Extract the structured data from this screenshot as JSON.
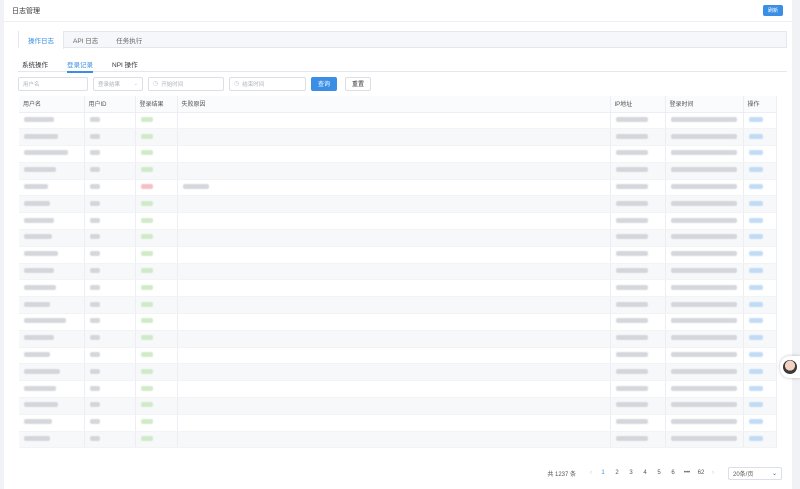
{
  "header": {
    "title": "日志管理",
    "refresh_label": "刷新"
  },
  "top_tabs": [
    {
      "label": "操作日志",
      "active": true
    },
    {
      "label": "API 日志",
      "active": false
    },
    {
      "label": "任务执行",
      "active": false
    }
  ],
  "sub_tabs": [
    {
      "label": "系统操作",
      "active": false
    },
    {
      "label": "登录记录",
      "active": true
    },
    {
      "label": "NPI 操作",
      "active": false
    }
  ],
  "filters": {
    "username_placeholder": "用户名",
    "result_placeholder": "登录结果",
    "start_placeholder": "开始时间",
    "end_placeholder": "结束时间",
    "query_label": "查询",
    "reset_label": "重置"
  },
  "table": {
    "columns": [
      "用户名",
      "用户ID",
      "登录结果",
      "失败原因",
      "IP地址",
      "登录时间",
      "操作"
    ]
  },
  "pagination": {
    "total_text": "共 1237 条",
    "pages": [
      "1",
      "2",
      "3",
      "4",
      "5",
      "6"
    ],
    "current": "1",
    "ellipsis": "•••",
    "last": "62",
    "page_size": "20条/页"
  },
  "colors": {
    "accent": "#3a8ee6",
    "success": "#c9e8c0",
    "fail": "#f4b6bc"
  }
}
